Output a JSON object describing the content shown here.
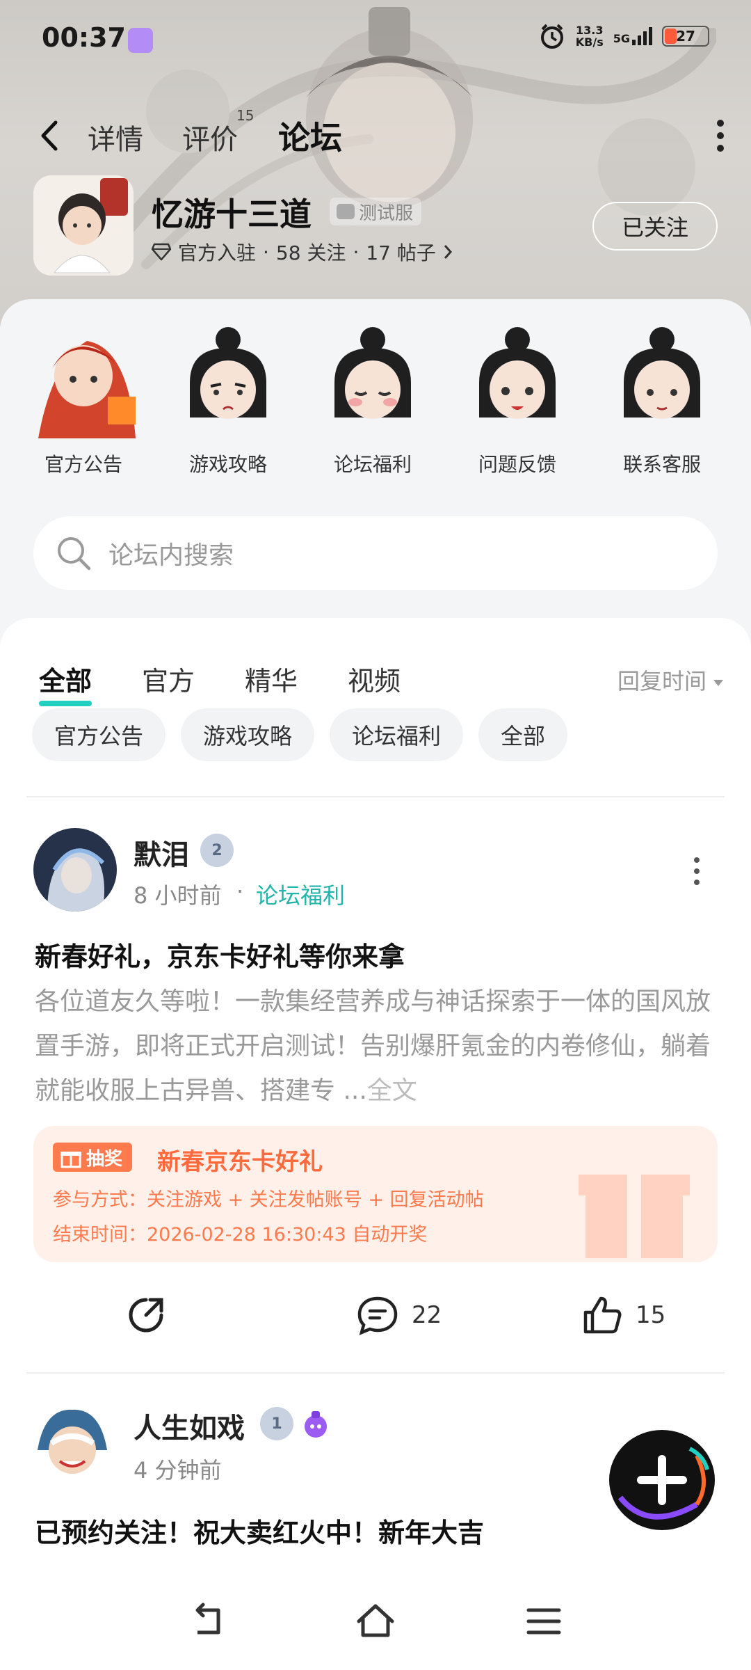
{
  "status_bar": {
    "time": "00:37",
    "net_speed_value": "13.3",
    "net_speed_unit": "KB/s",
    "network": "5G",
    "battery": "27"
  },
  "top_nav": {
    "tabs": [
      {
        "label": "详情",
        "active": false
      },
      {
        "label": "评价",
        "badge": "15",
        "active": false
      },
      {
        "label": "论坛",
        "active": true
      }
    ]
  },
  "game": {
    "title": "忆游十三道",
    "test_tag": "测试服",
    "official": "官方入驻",
    "follows": "58 关注",
    "posts": "17 帖子",
    "sep": "·",
    "follow_button": "已关注"
  },
  "categories": [
    {
      "label": "官方公告"
    },
    {
      "label": "游戏攻略"
    },
    {
      "label": "论坛福利"
    },
    {
      "label": "问题反馈"
    },
    {
      "label": "联系客服"
    }
  ],
  "search": {
    "placeholder": "论坛内搜索"
  },
  "filter_tabs": [
    {
      "label": "全部",
      "active": true
    },
    {
      "label": "官方",
      "active": false
    },
    {
      "label": "精华",
      "active": false
    },
    {
      "label": "视频",
      "active": false
    }
  ],
  "sort_label": "回复时间",
  "chips": [
    "官方公告",
    "游戏攻略",
    "论坛福利",
    "全部"
  ],
  "post1": {
    "author": "默泪",
    "level": "2",
    "time": "8 小时前",
    "sep": "·",
    "category": "论坛福利",
    "title": "新春好礼，京东卡好礼等你来拿",
    "body": "各位道友久等啦！一款集经营养成与神话探索于一体的国风放置手游，即将正式开启测试！告别爆肝氪金的内卷修仙，躺着就能收服上古异兽、搭建专 ...",
    "full_text": "全文",
    "lottery": {
      "tag": "抽奖",
      "title": "新春京东卡好礼",
      "method": "参与方式：关注游戏 + 关注发帖账号 + 回复活动帖",
      "end": "结束时间：2026-02-28 16:30:43 自动开奖"
    },
    "comments": "22",
    "likes": "15"
  },
  "post2": {
    "author": "人生如戏",
    "level": "1",
    "time": "4 分钟前",
    "title": "已预约关注！祝大卖红火中！新年大吉"
  },
  "colors": {
    "accent": "#23cfc1",
    "lottery": "#ff7a4c"
  }
}
